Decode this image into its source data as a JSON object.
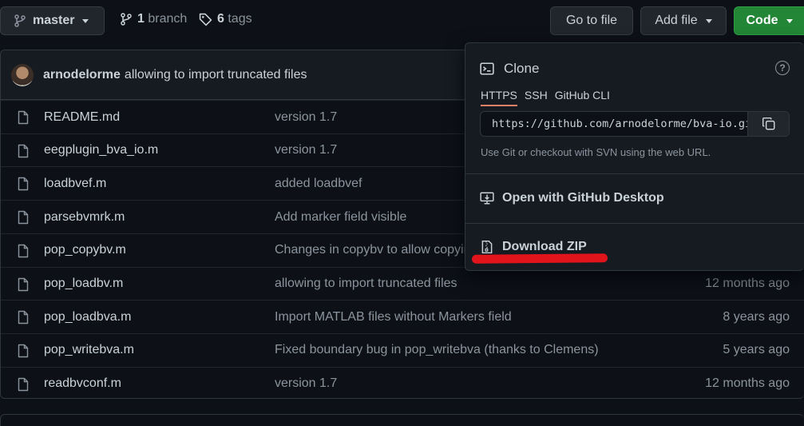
{
  "toolbar": {
    "branch_label": "master",
    "branch_count": "1",
    "branch_text": "branch",
    "tag_count": "6",
    "tag_text": "tags",
    "goto_label": "Go to file",
    "addfile_label": "Add file",
    "code_label": "Code"
  },
  "commit": {
    "author": "arnodelorme",
    "message": "allowing to import truncated files"
  },
  "files": [
    {
      "name": "README.md",
      "message": "version 1.7",
      "age": ""
    },
    {
      "name": "eegplugin_bva_io.m",
      "message": "version 1.7",
      "age": ""
    },
    {
      "name": "loadbvef.m",
      "message": "added loadbvef",
      "age": ""
    },
    {
      "name": "parsebvmrk.m",
      "message": "Add marker field visible",
      "age": ""
    },
    {
      "name": "pop_copybv.m",
      "message": "Changes in copybv to allow copyin",
      "age": ""
    },
    {
      "name": "pop_loadbv.m",
      "message": "allowing to import truncated files",
      "age": "12 months ago"
    },
    {
      "name": "pop_loadbva.m",
      "message": "Import MATLAB files without Markers field",
      "age": "8 years ago"
    },
    {
      "name": "pop_writebva.m",
      "message": "Fixed boundary bug in pop_writebva (thanks to Clemens)",
      "age": "5 years ago"
    },
    {
      "name": "readbvconf.m",
      "message": "version 1.7",
      "age": "12 months ago"
    }
  ],
  "clone": {
    "title": "Clone",
    "help": "?",
    "tabs": [
      "HTTPS",
      "SSH",
      "GitHub CLI"
    ],
    "url": "https://github.com/arnodelorme/bva-io.git",
    "hint": "Use Git or checkout with SVN using the web URL.",
    "desktop_label": "Open with GitHub Desktop",
    "zip_label": "Download ZIP"
  },
  "colors": {
    "background": "#0d1117",
    "code_button": "#238636",
    "annotation": "#e0141a",
    "active_tab": "#f78166"
  }
}
